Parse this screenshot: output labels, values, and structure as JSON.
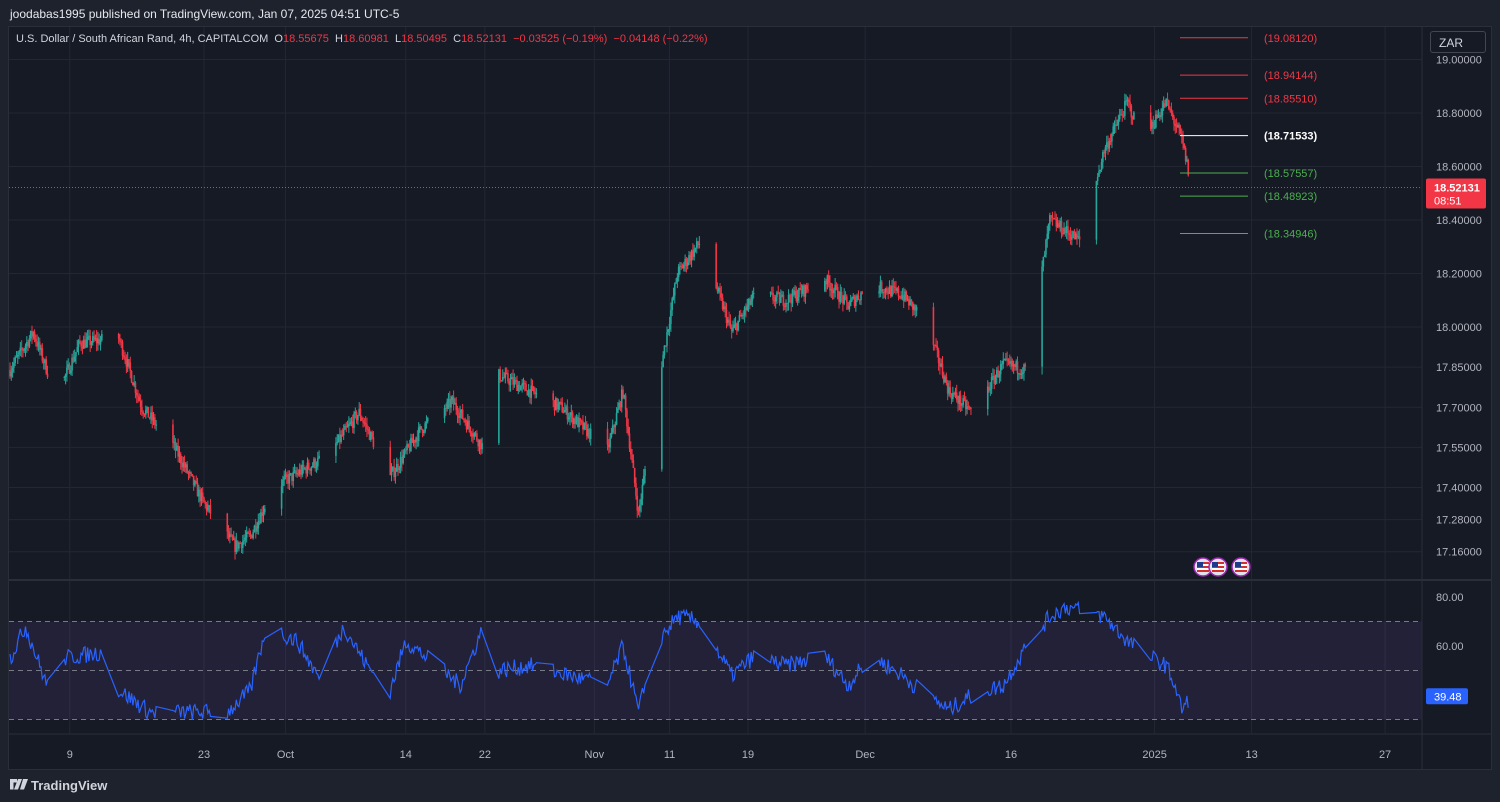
{
  "header": {
    "publisher_line": "joodabas1995 published on TradingView.com, Jan 07, 2025 04:51 UTC-5"
  },
  "legend": {
    "symbol": "U.S. Dollar / South African Rand, 4h, CAPITALCOM",
    "o_label": "O",
    "o_value": "18.55675",
    "h_label": "H",
    "h_value": "18.60981",
    "l_label": "L",
    "l_value": "18.50495",
    "c_label": "C",
    "c_value": "18.52131",
    "change": "−0.03525 (−0.19%)",
    "change2": "−0.04148 (−0.22%)"
  },
  "currency_button": "ZAR",
  "last_price": {
    "value": "18.52131",
    "countdown": "08:51"
  },
  "rsi_value": "39.48",
  "footer": {
    "brand": "TradingView"
  },
  "colors": {
    "up": "#26a69a",
    "down": "#f23645",
    "rsi_line": "#2962ff",
    "rsi_band": "#7e57c2",
    "background": "#161a25",
    "level_red": "#f23645",
    "level_green": "#4caf50",
    "level_white": "#ffffff"
  },
  "icons": [
    "us-flag-event-icon",
    "us-flag-event-icon",
    "us-flag-event-icon"
  ],
  "chart_data": [
    {
      "type": "candlestick",
      "price_axis_ticks": [
        "19.00000",
        "18.80000",
        "18.60000",
        "18.40000",
        "18.20000",
        "18.00000",
        "17.85000",
        "17.70000",
        "17.55000",
        "17.40000",
        "17.28000",
        "17.16000"
      ],
      "time_axis_ticks": [
        "9",
        "23",
        "Oct",
        "14",
        "22",
        "Nov",
        "11",
        "19",
        "Dec",
        "16",
        "2025",
        "13",
        "27"
      ],
      "anchors": [
        {
          "d": 0,
          "p": 17.84
        },
        {
          "d": 3,
          "p": 17.98
        },
        {
          "d": 6,
          "p": 17.74
        },
        {
          "d": 9,
          "p": 17.94
        },
        {
          "d": 14,
          "p": 17.96
        },
        {
          "d": 17,
          "p": 17.7
        },
        {
          "d": 21,
          "p": 17.56
        },
        {
          "d": 25,
          "p": 17.34
        },
        {
          "d": 29,
          "p": 17.18
        },
        {
          "d": 31,
          "p": 17.22
        },
        {
          "d": 34,
          "p": 17.4
        },
        {
          "d": 41,
          "p": 17.52
        },
        {
          "d": 45,
          "p": 17.68
        },
        {
          "d": 49,
          "p": 17.44
        },
        {
          "d": 53,
          "p": 17.62
        },
        {
          "d": 57,
          "p": 17.72
        },
        {
          "d": 61,
          "p": 17.55
        },
        {
          "d": 63,
          "p": 17.82
        },
        {
          "d": 71,
          "p": 17.7
        },
        {
          "d": 77,
          "p": 17.54
        },
        {
          "d": 79,
          "p": 17.76
        },
        {
          "d": 81,
          "p": 17.3
        },
        {
          "d": 83,
          "p": 17.7
        },
        {
          "d": 86,
          "p": 18.2
        },
        {
          "d": 89,
          "p": 18.32
        },
        {
          "d": 93,
          "p": 17.98
        },
        {
          "d": 96,
          "p": 18.12
        },
        {
          "d": 100,
          "p": 18.1
        },
        {
          "d": 105,
          "p": 18.18
        },
        {
          "d": 108,
          "p": 18.08
        },
        {
          "d": 111,
          "p": 18.16
        },
        {
          "d": 115,
          "p": 18.12
        },
        {
          "d": 118,
          "p": 18.02
        },
        {
          "d": 121,
          "p": 17.76
        },
        {
          "d": 124,
          "p": 17.68
        },
        {
          "d": 128,
          "p": 17.86
        },
        {
          "d": 131,
          "p": 17.84
        },
        {
          "d": 134,
          "p": 18.4
        },
        {
          "d": 138,
          "p": 18.32
        },
        {
          "d": 141,
          "p": 18.66
        },
        {
          "d": 144,
          "p": 18.84
        },
        {
          "d": 146,
          "p": 18.7
        },
        {
          "d": 149,
          "p": 18.84
        },
        {
          "d": 151,
          "p": 18.7
        },
        {
          "d": 152.3,
          "p": 18.52
        }
      ],
      "horizontal_levels": [
        {
          "label": "(19.08120)",
          "value": 19.0812,
          "color": "red"
        },
        {
          "label": "(18.94144)",
          "value": 18.94144,
          "color": "red"
        },
        {
          "label": "(18.85510)",
          "value": 18.8551,
          "color": "red"
        },
        {
          "label": "(18.71533)",
          "value": 18.71533,
          "color": "white"
        },
        {
          "label": "(18.57557)",
          "value": 18.57557,
          "color": "green"
        },
        {
          "label": "(18.48923)",
          "value": 18.48923,
          "color": "green"
        },
        {
          "label": "(18.34946)",
          "value": 18.34946,
          "color": "green"
        }
      ],
      "last_price": 18.52131
    },
    {
      "type": "line",
      "name": "RSI",
      "ticks": [
        "80.00",
        "60.00"
      ],
      "band": [
        30,
        70
      ],
      "midline": 50,
      "anchors": [
        {
          "d": 0,
          "v": 55
        },
        {
          "d": 2,
          "v": 68
        },
        {
          "d": 5,
          "v": 42
        },
        {
          "d": 6,
          "v": 33
        },
        {
          "d": 7,
          "v": 55
        },
        {
          "d": 13,
          "v": 58
        },
        {
          "d": 14,
          "v": 42
        },
        {
          "d": 18,
          "v": 33
        },
        {
          "d": 25,
          "v": 33
        },
        {
          "d": 28,
          "v": 33
        },
        {
          "d": 31,
          "v": 42
        },
        {
          "d": 33,
          "v": 68
        },
        {
          "d": 37,
          "v": 62
        },
        {
          "d": 40,
          "v": 46
        },
        {
          "d": 43,
          "v": 68
        },
        {
          "d": 46,
          "v": 52
        },
        {
          "d": 49,
          "v": 42
        },
        {
          "d": 51,
          "v": 62
        },
        {
          "d": 55,
          "v": 52
        },
        {
          "d": 58,
          "v": 44
        },
        {
          "d": 61,
          "v": 68
        },
        {
          "d": 63,
          "v": 50
        },
        {
          "d": 67,
          "v": 52
        },
        {
          "d": 72,
          "v": 48
        },
        {
          "d": 77,
          "v": 44
        },
        {
          "d": 79,
          "v": 60
        },
        {
          "d": 81,
          "v": 33
        },
        {
          "d": 83,
          "v": 60
        },
        {
          "d": 86,
          "v": 72
        },
        {
          "d": 89,
          "v": 70
        },
        {
          "d": 93,
          "v": 48
        },
        {
          "d": 96,
          "v": 56
        },
        {
          "d": 100,
          "v": 52
        },
        {
          "d": 105,
          "v": 56
        },
        {
          "d": 108,
          "v": 44
        },
        {
          "d": 111,
          "v": 56
        },
        {
          "d": 115,
          "v": 48
        },
        {
          "d": 118,
          "v": 40
        },
        {
          "d": 121,
          "v": 34
        },
        {
          "d": 124,
          "v": 40
        },
        {
          "d": 128,
          "v": 44
        },
        {
          "d": 131,
          "v": 60
        },
        {
          "d": 134,
          "v": 72
        },
        {
          "d": 136,
          "v": 76
        },
        {
          "d": 141,
          "v": 72
        },
        {
          "d": 144,
          "v": 62
        },
        {
          "d": 146,
          "v": 57
        },
        {
          "d": 149,
          "v": 52
        },
        {
          "d": 150,
          "v": 45
        },
        {
          "d": 151,
          "v": 34
        },
        {
          "d": 152.3,
          "v": 39.48
        }
      ]
    }
  ]
}
